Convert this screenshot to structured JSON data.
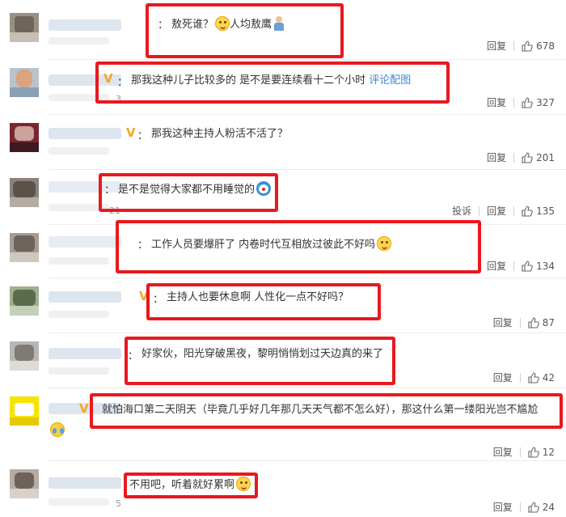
{
  "actions": {
    "reply_label": "回复",
    "report_label": "投诉"
  },
  "comments": [
    {
      "text": "敖死谁？",
      "text2": "人均敖鹰",
      "likes": "678"
    },
    {
      "text": "那我这种儿子比较多的 是不是要连续看十二个小时",
      "link": "评论配图",
      "likes": "327",
      "frag": "3"
    },
    {
      "text": "那我这种主持人粉活不活了？",
      "likes": "201"
    },
    {
      "text": "是不是觉得大家都不用睡觉的",
      "likes": "135",
      "frag": "21"
    },
    {
      "text": "工作人员要爆肝了 内卷时代互相放过彼此不好吗",
      "likes": "134"
    },
    {
      "text": "主持人也要休息啊 人性化一点不好吗？",
      "likes": "87"
    },
    {
      "text": "好家伙，阳光穿破黑夜，黎明悄悄划过天边真的来了",
      "likes": "42"
    },
    {
      "text": "就怕海口第二天阴天（毕竟几乎好几年那几天天气都不怎么好），那这什么第一缕阳光岂不尴尬",
      "likes": "12"
    },
    {
      "text": "不用吧，听着就好累啊",
      "likes": "24",
      "frag": "5"
    }
  ]
}
